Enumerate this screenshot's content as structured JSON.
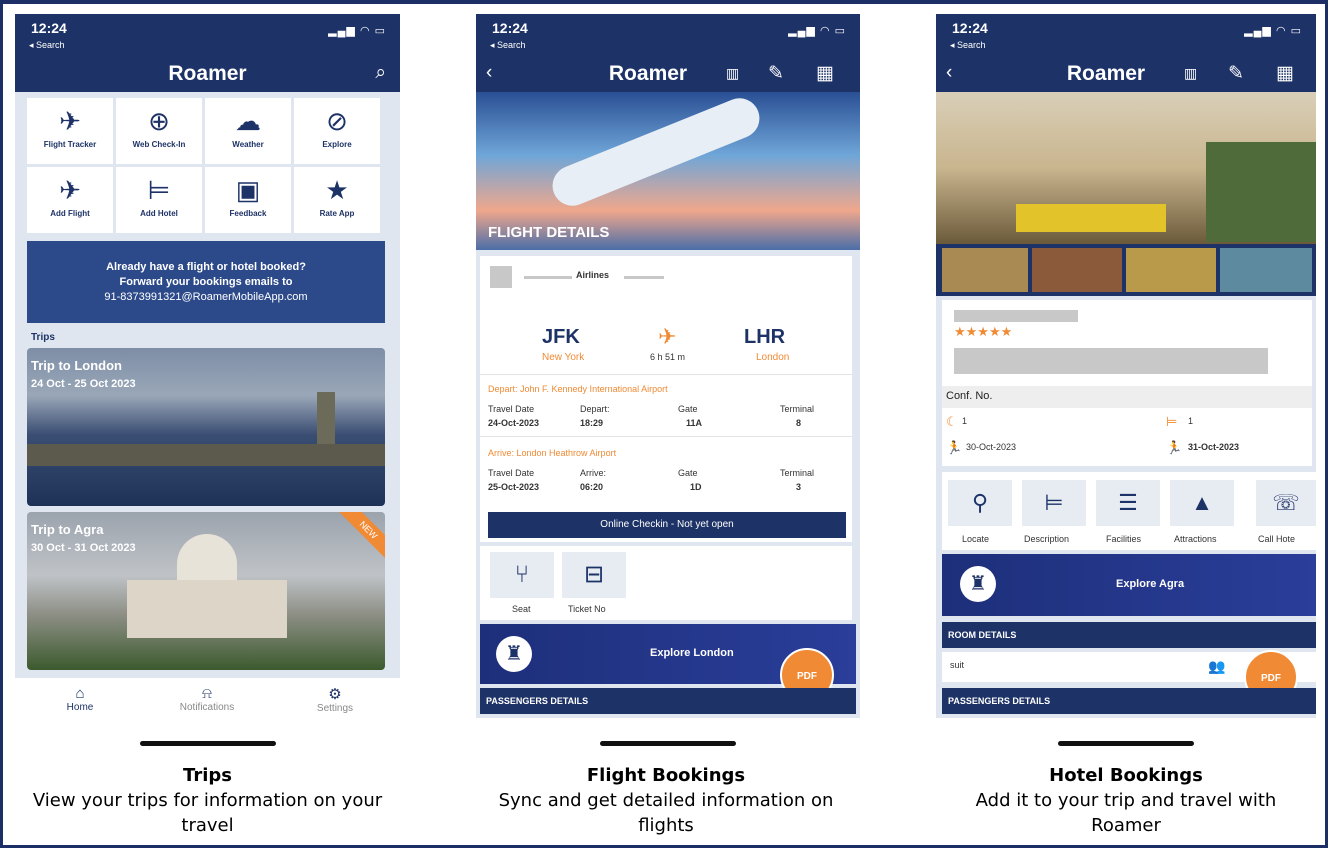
{
  "phones": {
    "status_time": "12:24",
    "status_back": "◂ Search",
    "brand": "Roamer"
  },
  "home": {
    "tiles": [
      "Flight Tracker",
      "Web Check-In",
      "Weather",
      "Explore",
      "Add Flight",
      "Add Hotel",
      "Feedback",
      "Rate App"
    ],
    "promo": [
      "Already have a flight or hotel booked?",
      "Forward your bookings emails to",
      "91-8373991321@RoamerMobileApp.com"
    ],
    "trips_label": "Trips",
    "trips": [
      {
        "title": "Trip to London",
        "date": "24 Oct - 25 Oct 2023"
      },
      {
        "title": "Trip to Agra",
        "date": "30 Oct - 31 Oct 2023",
        "badge": "NEW"
      }
    ],
    "tabs": [
      "Home",
      "Notifications",
      "Settings"
    ]
  },
  "flight": {
    "header": "FLIGHT DETAILS",
    "airline": "Airlines",
    "from_code": "JFK",
    "from_city": "New York",
    "duration": "6 h 51 m",
    "to_code": "LHR",
    "to_city": "London",
    "depart_label": "Depart:  John F. Kennedy International Airport",
    "arrive_label": "Arrive:  London Heathrow Airport",
    "cols": [
      "Travel Date",
      "Depart:",
      "Gate",
      "Terminal"
    ],
    "cols_arr": [
      "Travel Date",
      "Arrive:",
      "Gate",
      "Terminal"
    ],
    "dep_vals": [
      "24-Oct-2023",
      "18:29",
      "11A",
      "8"
    ],
    "arr_vals": [
      "25-Oct-2023",
      "06:20",
      "1D",
      "3"
    ],
    "checkin": "Online Checkin - Not yet open",
    "actions": [
      "Seat",
      "Ticket No"
    ],
    "explore": "Explore London",
    "pdf": "PDF",
    "passengers": "PASSENGERS DETAILS"
  },
  "hotel": {
    "stars": "★★★★★",
    "conf": "Conf. No.",
    "nights": "1",
    "rooms": "1",
    "checkin": "30-Oct-2023",
    "checkout": "31-Oct-2023",
    "actions": [
      "Locate",
      "Description",
      "Facilities",
      "Attractions",
      "Call Hote"
    ],
    "explore": "Explore Agra",
    "room_details": "ROOM DETAILS",
    "room_type": "suit",
    "pdf": "PDF",
    "passengers": "PASSENGERS DETAILS"
  },
  "captions": [
    {
      "title": "Trips",
      "text": "View your trips for information on your travel"
    },
    {
      "title": "Flight Bookings",
      "text": "Sync and get detailed information on flights"
    },
    {
      "title": "Hotel Bookings",
      "text": "Add it to your trip and travel with Roamer"
    }
  ]
}
